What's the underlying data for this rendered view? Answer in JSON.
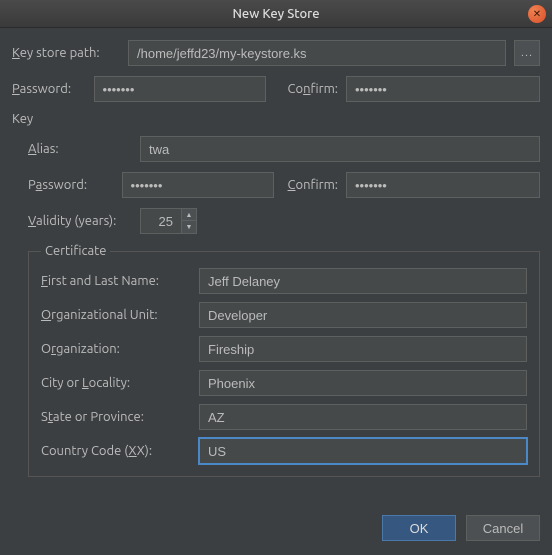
{
  "title": "New Key Store",
  "top": {
    "keystore_path_label": "Key store path:",
    "keystore_path_value": "/home/jeffd23/my-keystore.ks",
    "password_label": "Password:",
    "password_value": "•••••••",
    "confirm_label": "Confirm:",
    "confirm_value": "•••••••"
  },
  "key": {
    "section_label": "Key",
    "alias_label": "Alias:",
    "alias_value": "twa",
    "password_label": "Password:",
    "password_value": "•••••••",
    "confirm_label": "Confirm:",
    "confirm_value": "•••••••",
    "validity_label": "Validity (years):",
    "validity_value": "25"
  },
  "cert": {
    "legend": "Certificate",
    "first_last_label": "First and Last Name:",
    "first_last_value": "Jeff Delaney",
    "org_unit_label": "Organizational Unit:",
    "org_unit_value": "Developer",
    "org_label": "Organization:",
    "org_value": "Fireship",
    "city_label": "City or Locality:",
    "city_value": "Phoenix",
    "state_label": "State or Province:",
    "state_value": "AZ",
    "country_label": "Country Code (XX):",
    "country_value": "US"
  },
  "footer": {
    "ok": "OK",
    "cancel": "Cancel"
  },
  "icons": {
    "browse": "..."
  }
}
